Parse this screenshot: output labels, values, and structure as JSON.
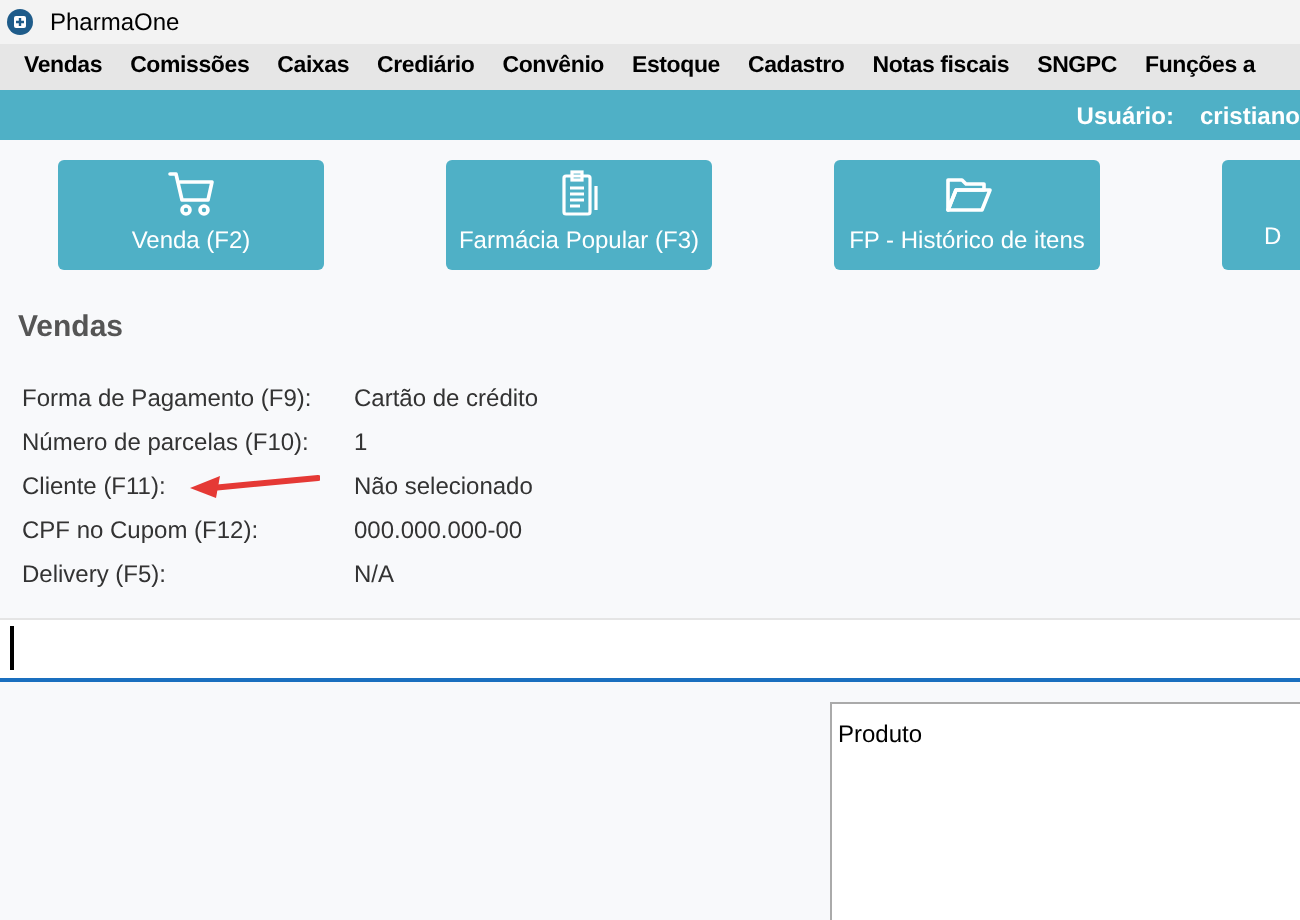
{
  "window": {
    "title": "PharmaOne"
  },
  "menu": [
    "Vendas",
    "Comissões",
    "Caixas",
    "Crediário",
    "Convênio",
    "Estoque",
    "Cadastro",
    "Notas fiscais",
    "SNGPC",
    "Funções a"
  ],
  "user_bar": {
    "label": "Usuário:",
    "value": "cristiano"
  },
  "actions": [
    {
      "label": "Venda (F2)",
      "kind": "cart"
    },
    {
      "label": "Farmácia Popular (F3)",
      "kind": "clipboard"
    },
    {
      "label": "FP - Histórico de itens",
      "kind": "folder"
    },
    {
      "label": "D",
      "kind": "cut"
    }
  ],
  "section": {
    "title": "Vendas"
  },
  "fields": [
    {
      "label": "Forma de Pagamento (F9):",
      "value": "Cartão de crédito"
    },
    {
      "label": "Número de parcelas (F10):",
      "value": "1"
    },
    {
      "label": "Cliente (F11):",
      "value": "Não selecionado"
    },
    {
      "label": "CPF no Cupom (F12):",
      "value": "000.000.000-00"
    },
    {
      "label": "Delivery (F5):",
      "value": "N/A"
    }
  ],
  "products": {
    "column_1": "Produto"
  }
}
